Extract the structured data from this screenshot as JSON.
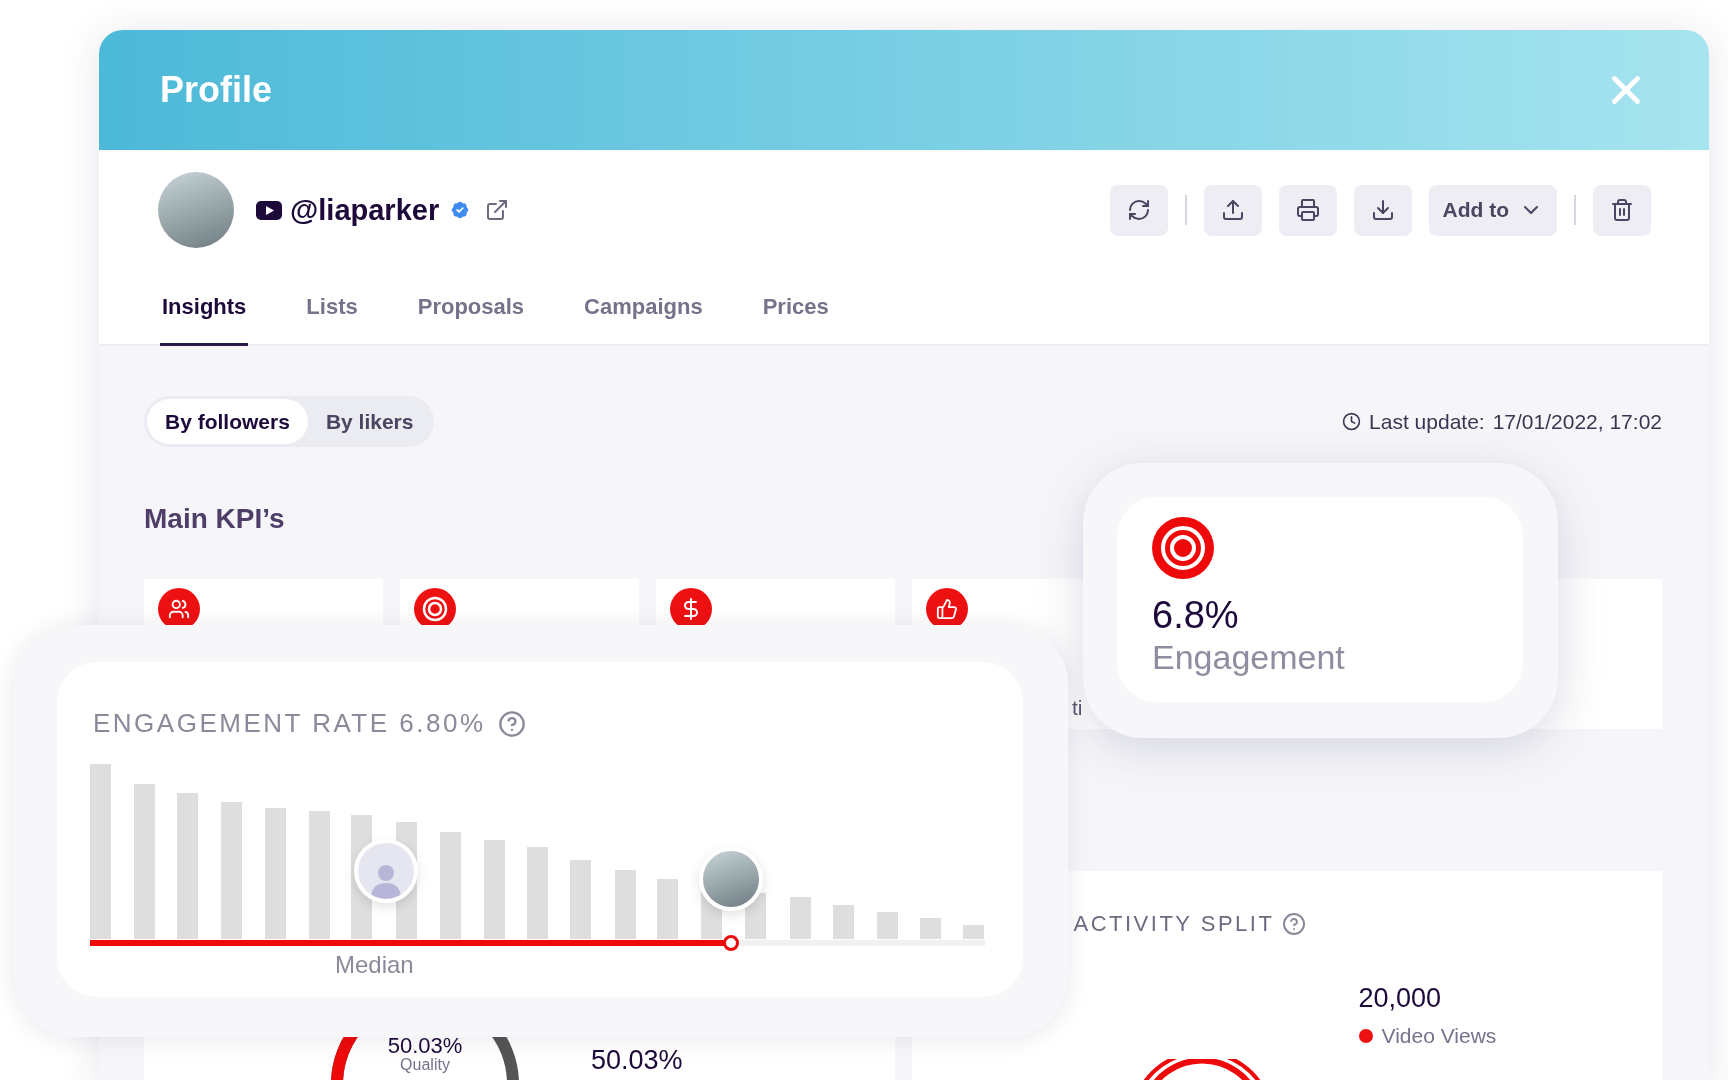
{
  "window": {
    "title": "Profile"
  },
  "profile": {
    "handle": "@liaparker",
    "verified": true
  },
  "actions": [
    {
      "kind": "refresh"
    },
    {
      "kind": "divider"
    },
    {
      "kind": "share"
    },
    {
      "kind": "print"
    },
    {
      "kind": "download"
    },
    {
      "kind": "menu",
      "label": "Add to"
    },
    {
      "kind": "divider"
    },
    {
      "kind": "delete"
    }
  ],
  "tabs": [
    {
      "label": "Insights",
      "selected": true
    },
    {
      "label": "Lists",
      "selected": false
    },
    {
      "label": "Proposals",
      "selected": false
    },
    {
      "label": "Campaigns",
      "selected": false
    },
    {
      "label": "Prices",
      "selected": false
    }
  ],
  "segments": [
    {
      "label": "By followers",
      "selected": true
    },
    {
      "label": "By likers",
      "selected": false
    }
  ],
  "last_update": {
    "label": "Last update:",
    "value": "17/01/2022, 17:02"
  },
  "section_title": "Main KPI’s",
  "kpi_cards": [
    {
      "kind": "followers"
    },
    {
      "kind": "engagement"
    },
    {
      "kind": "price"
    },
    {
      "kind": "likes",
      "label": "ti"
    }
  ],
  "engagement_chart": {
    "title": "ENGAGEMENT RATE 6.80%",
    "median_label": "Median",
    "level": 0.716
  },
  "highlight": {
    "value": "6.8%",
    "label": "Engagement"
  },
  "quality": {
    "value": "50.03%",
    "label": "Quality",
    "side_value": "50.03%"
  },
  "activity": {
    "title": "ACTIVITY SPLIT",
    "value": "20,000",
    "legend": [
      {
        "label": "Video Views",
        "color": "#ee1111"
      }
    ]
  }
}
